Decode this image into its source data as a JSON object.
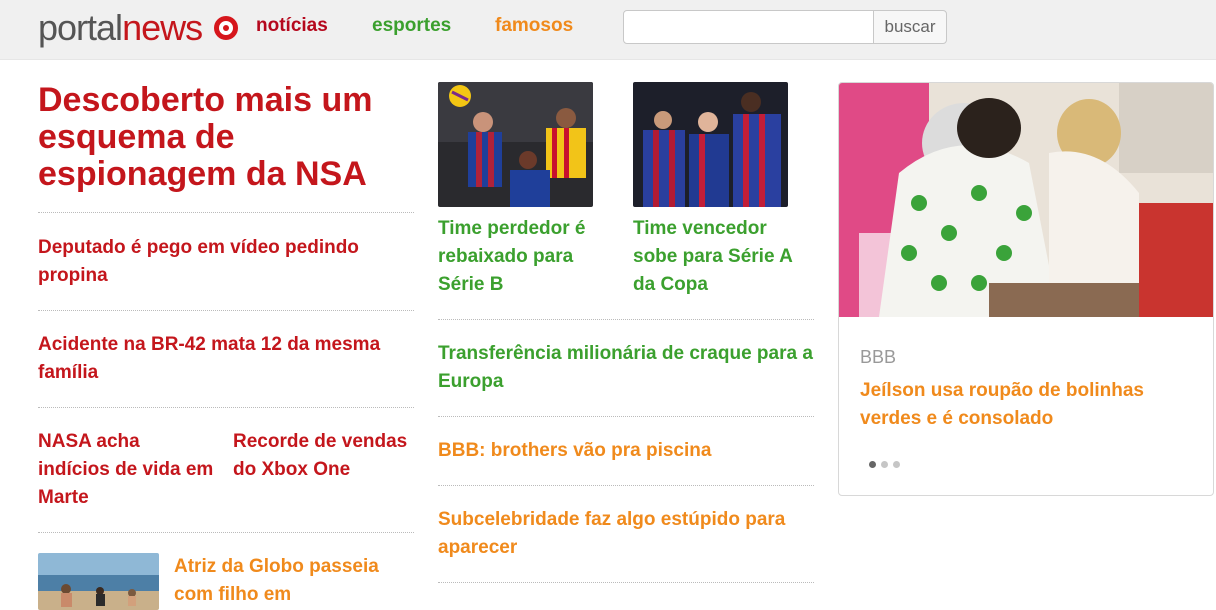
{
  "header": {
    "logo_portal": "portal",
    "logo_news": "news",
    "nav": {
      "noticias": "notícias",
      "esportes": "esportes",
      "famosos": "famosos"
    },
    "search": {
      "value": "",
      "placeholder": "",
      "button": "buscar"
    }
  },
  "left": {
    "headline": "Descoberto mais um esquema de espionagem da NSA",
    "story1": "Deputado é pego em vídeo pedindo propina",
    "story2": "Acidente na BR-42 mata 12 da mesma família",
    "story3": "NASA acha indícios de vida em Marte",
    "story4": "Recorde de vendas do Xbox One",
    "story5": "Atriz da Globo passeia com filho em"
  },
  "middle": {
    "sport1": "Time perdedor é rebaixado para Série B",
    "sport2": "Time vencedor sobe para Série A da Copa",
    "sport3": "Transferência milionária de craque para a Europa",
    "famous1": "BBB: brothers vão pra piscina",
    "famous2": "Subcelebridade faz algo estúpido para aparecer"
  },
  "card": {
    "tag": "BBB",
    "title": "Jeílson usa roupão de bolinhas verdes e é consolado"
  },
  "colors": {
    "red": "#c4161c",
    "green": "#3ba02e",
    "orange": "#f08a1c"
  }
}
